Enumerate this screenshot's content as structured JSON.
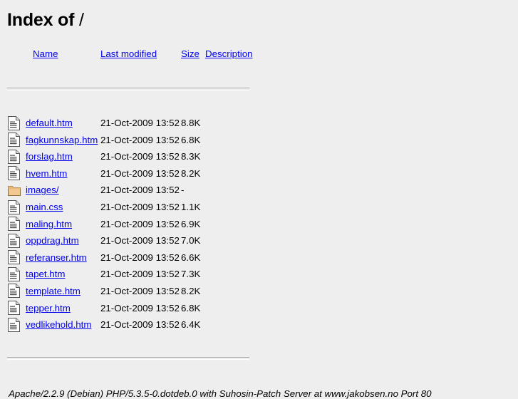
{
  "title": "Index of /",
  "title_main": "Index of",
  "title_path": "/",
  "colors": {
    "background": "#eeeeee",
    "link": "#0000ee",
    "text": "#000000",
    "rule": "#aaaaaa",
    "folder_icon": "#f0c890",
    "file_icon": "#ffffff"
  },
  "table": {
    "headers": {
      "name": "Name",
      "last_modified": "Last modified",
      "size": "Size",
      "description": "Description"
    },
    "rows": [
      {
        "icon": "file-text-icon",
        "name": "default.htm",
        "last_modified": "21-Oct-2009 13:52",
        "size": "8.8K",
        "description": ""
      },
      {
        "icon": "file-text-icon",
        "name": "fagkunnskap.htm",
        "last_modified": "21-Oct-2009 13:52",
        "size": "6.8K",
        "description": ""
      },
      {
        "icon": "file-text-icon",
        "name": "forslag.htm",
        "last_modified": "21-Oct-2009 13:52",
        "size": "8.3K",
        "description": ""
      },
      {
        "icon": "file-text-icon",
        "name": "hvem.htm",
        "last_modified": "21-Oct-2009 13:52",
        "size": "8.2K",
        "description": ""
      },
      {
        "icon": "folder-icon",
        "name": "images/",
        "last_modified": "21-Oct-2009 13:52",
        "size": "-",
        "description": ""
      },
      {
        "icon": "file-text-icon",
        "name": "main.css",
        "last_modified": "21-Oct-2009 13:52",
        "size": "1.1K",
        "description": ""
      },
      {
        "icon": "file-text-icon",
        "name": "maling.htm",
        "last_modified": "21-Oct-2009 13:52",
        "size": "6.9K",
        "description": ""
      },
      {
        "icon": "file-text-icon",
        "name": "oppdrag.htm",
        "last_modified": "21-Oct-2009 13:52",
        "size": "7.0K",
        "description": ""
      },
      {
        "icon": "file-text-icon",
        "name": "referanser.htm",
        "last_modified": "21-Oct-2009 13:52",
        "size": "6.6K",
        "description": ""
      },
      {
        "icon": "file-text-icon",
        "name": "tapet.htm",
        "last_modified": "21-Oct-2009 13:52",
        "size": "7.3K",
        "description": ""
      },
      {
        "icon": "file-text-icon",
        "name": "template.htm",
        "last_modified": "21-Oct-2009 13:52",
        "size": "8.2K",
        "description": ""
      },
      {
        "icon": "file-text-icon",
        "name": "tepper.htm",
        "last_modified": "21-Oct-2009 13:52",
        "size": "6.8K",
        "description": ""
      },
      {
        "icon": "file-text-icon",
        "name": "vedlikehold.htm",
        "last_modified": "21-Oct-2009 13:52",
        "size": "6.4K",
        "description": ""
      }
    ]
  },
  "footer": {
    "signature": "Apache/2.2.9 (Debian) PHP/5.3.5-0.dotdeb.0 with Suhosin-Patch Server at www.jakobsen.no Port 80"
  }
}
